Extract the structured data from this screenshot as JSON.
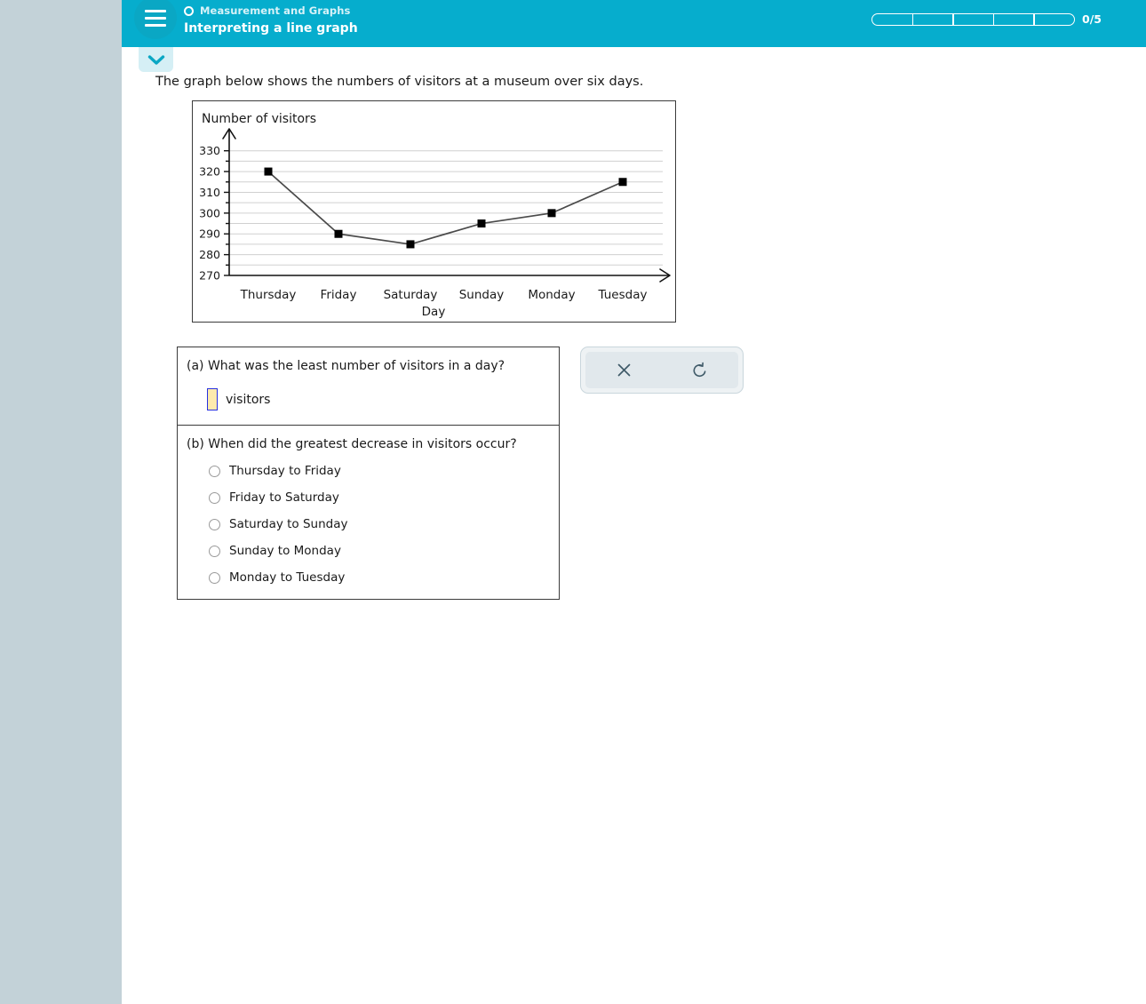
{
  "header": {
    "menu_icon": "hamburger-menu-icon",
    "course_icon": "circle-outline-icon",
    "course_name": "Measurement and Graphs",
    "lesson_title": "Interpreting a line graph",
    "progress_label": "0/5",
    "progress_segments": 5,
    "progress_filled": 0,
    "bg_color": "#06adcd"
  },
  "chevron_tab": {
    "icon": "chevron-down-icon",
    "bg_color": "#d5eff5"
  },
  "content": {
    "intro_text": "The graph below shows the numbers of visitors at a museum over six days."
  },
  "chart_data": {
    "type": "line",
    "title": "Number of visitors",
    "xlabel": "Day",
    "ylabel": "",
    "categories": [
      "Thursday",
      "Friday",
      "Saturday",
      "Sunday",
      "Monday",
      "Tuesday"
    ],
    "values": [
      320,
      290,
      285,
      295,
      300,
      315
    ],
    "ylim": [
      270,
      335
    ],
    "ytick_labels": [
      "270",
      "280",
      "290",
      "300",
      "310",
      "320",
      "330"
    ],
    "ytick_values": [
      270,
      280,
      290,
      300,
      310,
      320,
      330
    ],
    "minor_tick_step": 5,
    "grid": true,
    "grid_step": 5,
    "legend": "none",
    "marker": "square",
    "line_color": "#4a4a4a",
    "marker_color": "#000000",
    "grid_color": "#d0d0d0"
  },
  "questions": [
    {
      "id": "a",
      "prompt": "(a) What was the least number of visitors in a day?",
      "input_value": "",
      "input_placeholder": "",
      "unit_label": "visitors",
      "input_fill": "#fdeaae",
      "input_border": "#2730e0"
    },
    {
      "id": "b",
      "prompt": "(b) When did the greatest decrease in visitors occur?",
      "options": [
        "Thursday to Friday",
        "Friday to Saturday",
        "Saturday to Sunday",
        "Sunday to Monday",
        "Monday to Tuesday"
      ],
      "selected": null
    }
  ],
  "tools": {
    "clear_icon": "close-x-icon",
    "undo_icon": "undo-refresh-icon"
  },
  "sidebar": {
    "bg_color": "#c3d2d8"
  }
}
